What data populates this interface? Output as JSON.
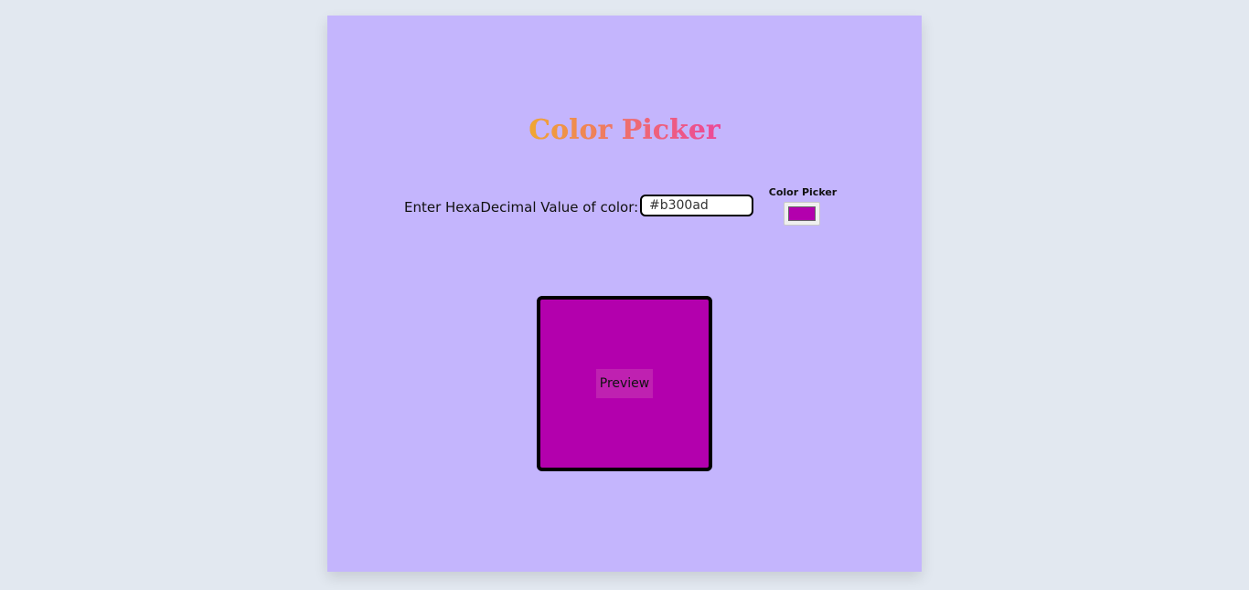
{
  "app": {
    "title": "Color Picker"
  },
  "form": {
    "hex_label": "Enter HexaDecimal Value of color:",
    "hex_value": "#b300ad",
    "picker_label": "Color Picker"
  },
  "preview": {
    "label": "Preview",
    "color": "#b300ad"
  },
  "colors": {
    "page_background": "#e2e8f0",
    "card_background": "#c4b5fd",
    "title_gradient_start": "#f0a830",
    "title_gradient_end": "#ec4899",
    "selected_color": "#b300ad"
  }
}
